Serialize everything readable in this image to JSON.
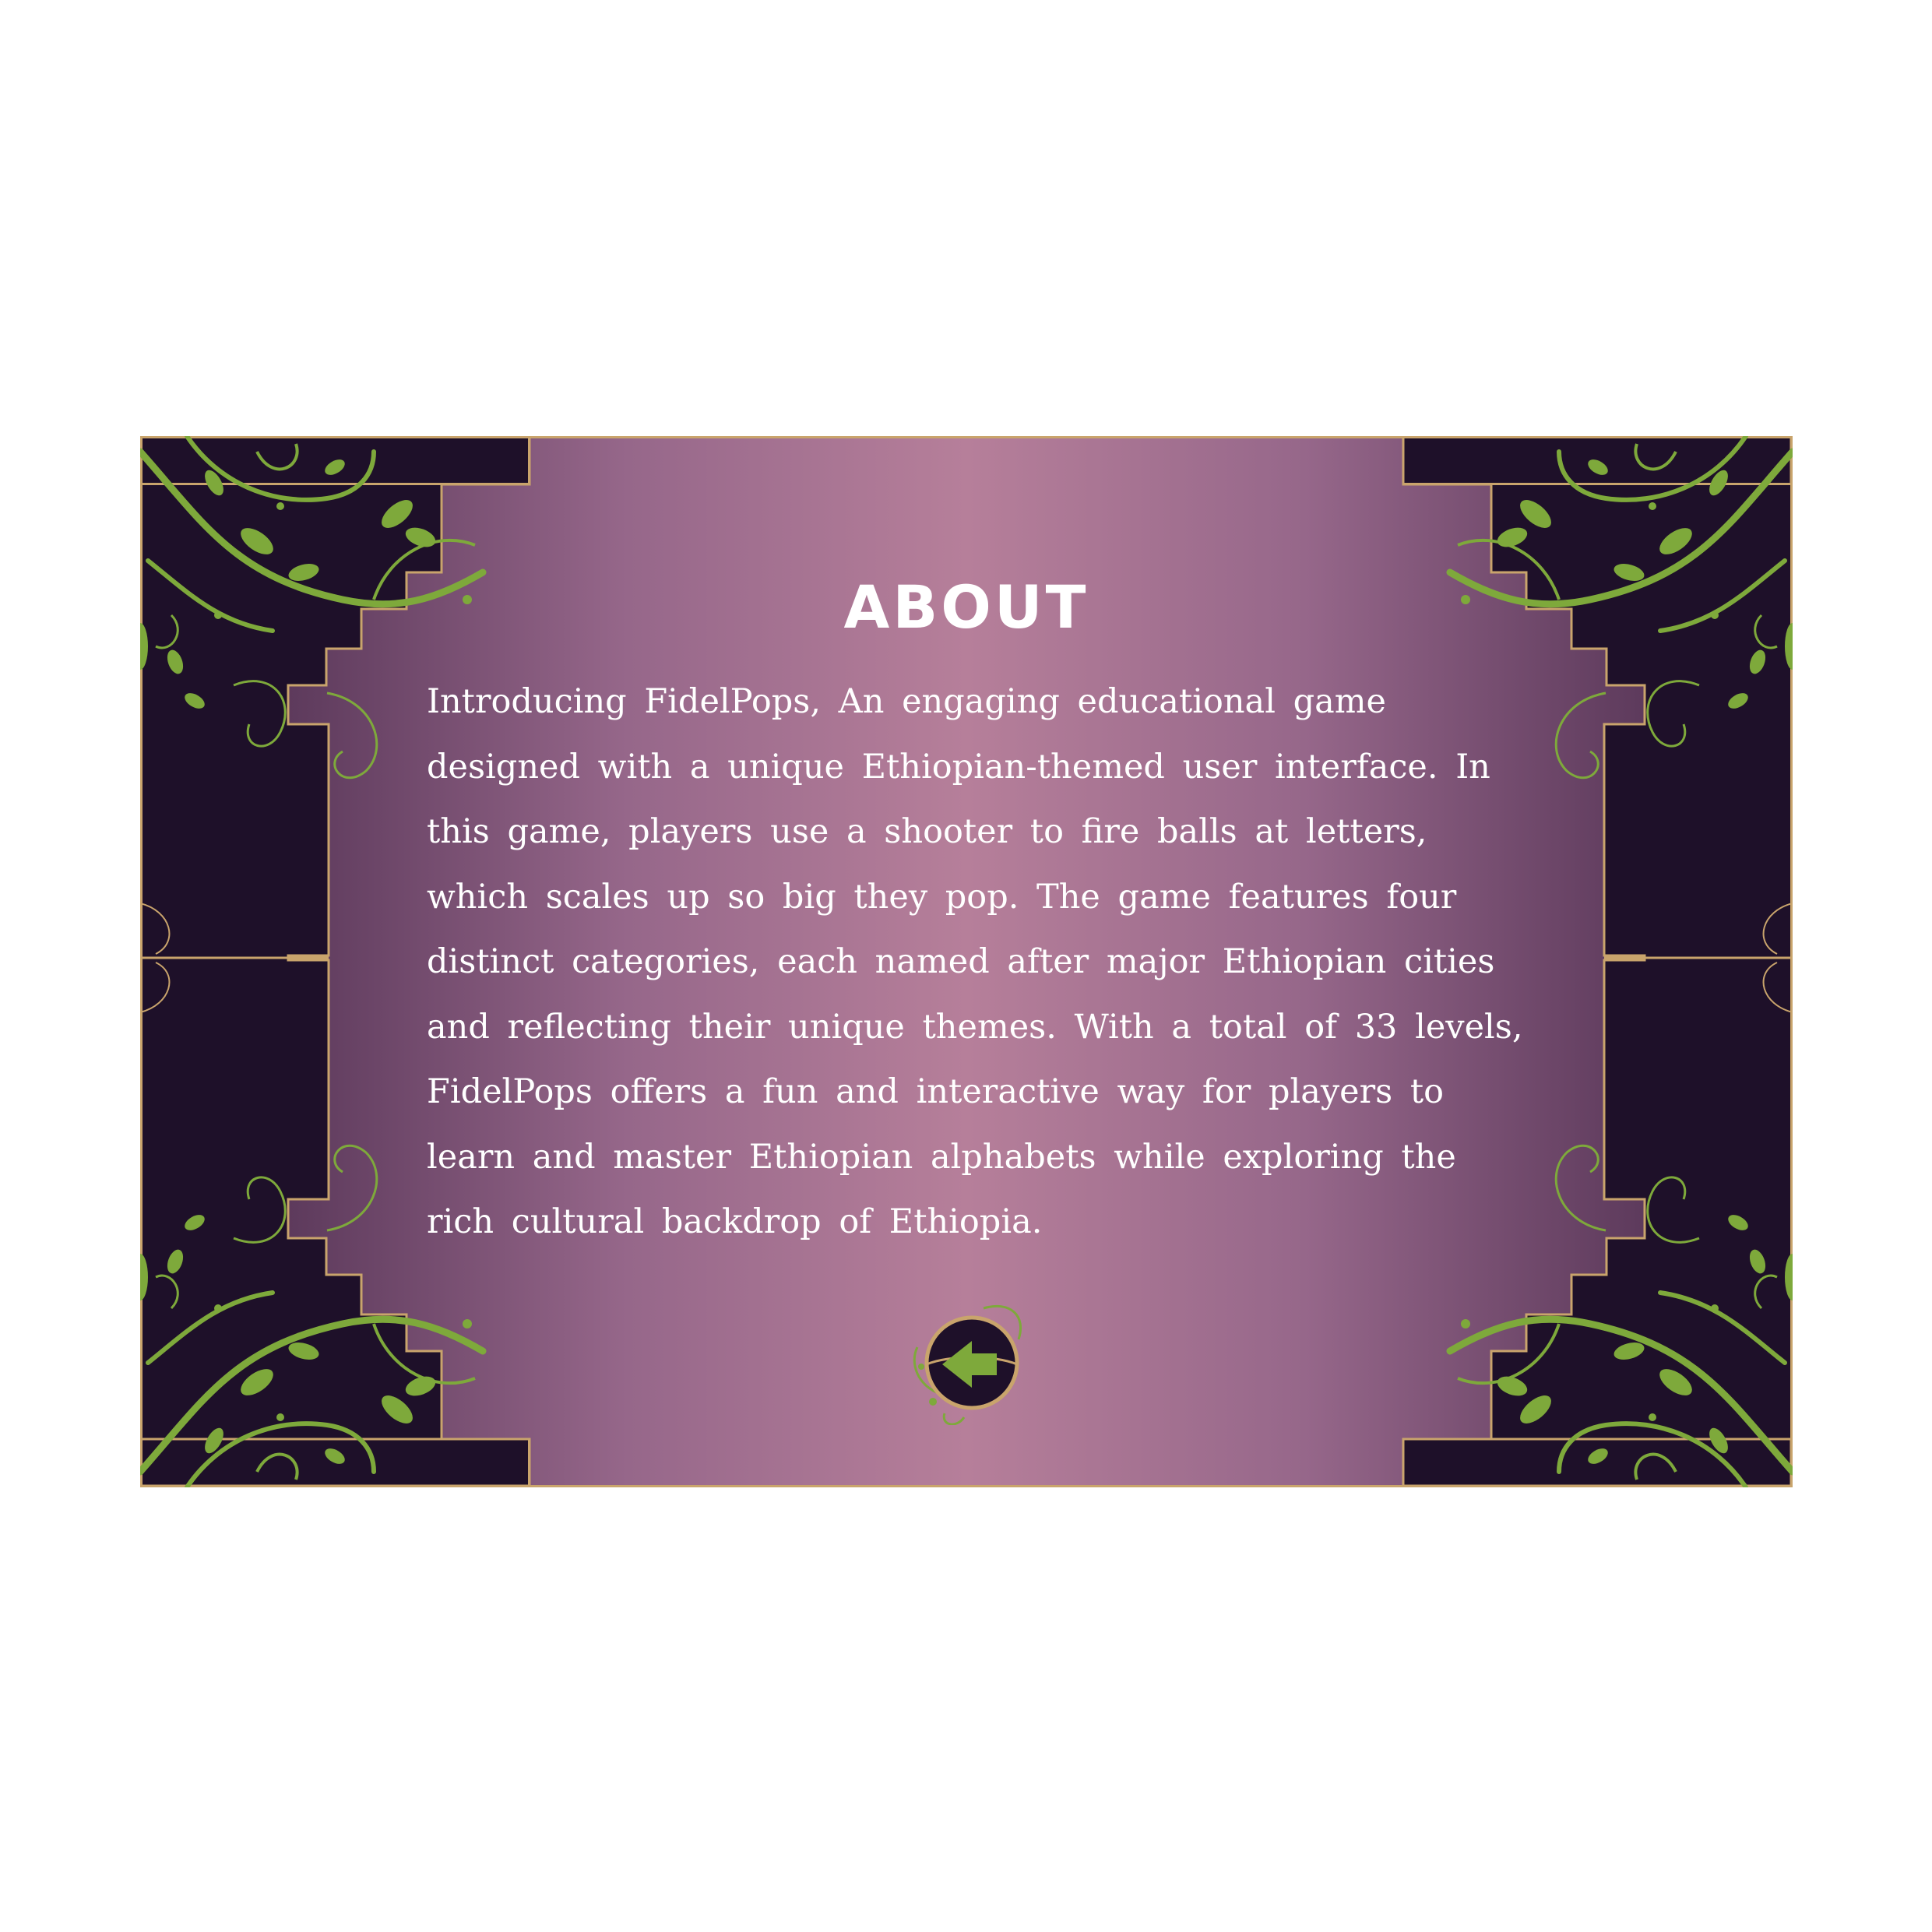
{
  "screen": {
    "title": "ABOUT",
    "description": "Introducing FidelPops, An engaging educational game designed with a unique Ethiopian-themed user interface. In this game, players use a shooter to fire balls at letters, which scales up so big they pop. The game features four distinct categories, each named after major Ethiopian cities and reflecting their unique themes. With a total of 33 levels, FidelPops offers a fun and interactive way for players to learn and master Ethiopian alphabets while exploring the rich cultural backdrop of Ethiopia."
  },
  "back_button": {
    "icon": "arrow-left-icon"
  },
  "theme": {
    "panel_dark": "#1e1029",
    "gradient_edge": "#6b4468",
    "gradient_center": "#b67f9a",
    "border_gold": "#c9a46c",
    "vine_green": "#7ea93b"
  }
}
